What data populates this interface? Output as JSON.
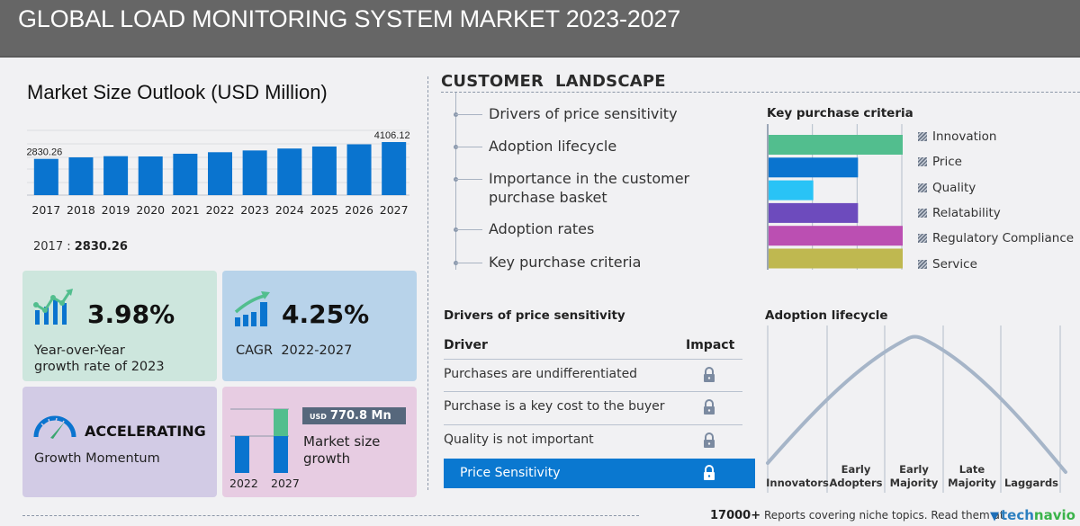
{
  "header": {
    "title": "GLOBAL LOAD MONITORING SYSTEM MARKET 2023-2027"
  },
  "market_size": {
    "title": "Market Size Outlook (USD Million)",
    "selected_year": "2017 :",
    "selected_value": "2830.26"
  },
  "chart_data": [
    {
      "type": "bar",
      "title": "Market Size Outlook (USD Million)",
      "categories": [
        "2017",
        "2018",
        "2019",
        "2020",
        "2021",
        "2022",
        "2023",
        "2024",
        "2025",
        "2026",
        "2027"
      ],
      "values": [
        2830.26,
        2945,
        3035,
        3015,
        3220,
        3335.3,
        3468.1,
        3615,
        3770,
        3935,
        4106.12
      ],
      "data_labels": {
        "2017": "2830.26",
        "2027": "4106.12"
      },
      "xlabel": "",
      "ylabel": "USD Million",
      "grid": true,
      "color": "#0a74cf"
    },
    {
      "type": "bar",
      "orientation": "horizontal",
      "title": "Key purchase criteria",
      "categories": [
        "Innovation",
        "Price",
        "Quality",
        "Relatability",
        "Regulatory Compliance",
        "Service"
      ],
      "values": [
        3,
        2,
        1,
        2,
        3,
        3
      ],
      "xlim": [
        0,
        3
      ],
      "colors": [
        "#52be8e",
        "#0a74cf",
        "#29c3f6",
        "#6d4bbd",
        "#bb4fb2",
        "#bfb850"
      ],
      "legend": "right"
    },
    {
      "type": "line",
      "title": "Adoption lifecycle",
      "categories": [
        "Innovators",
        "Early Adopters",
        "Early Majority",
        "Late Majority",
        "Laggards"
      ],
      "curve": "bell",
      "peak_stage": "Early Majority"
    }
  ],
  "cards": {
    "yoy": {
      "value": "3.98%",
      "label_line1": "Year-over-Year",
      "label_line2": "growth rate of 2023"
    },
    "cagr": {
      "value": "4.25%",
      "label": "CAGR  2022-2027"
    },
    "momentum": {
      "value": "ACCELERATING",
      "label": "Growth Momentum"
    },
    "growth": {
      "currency": "USD",
      "amount": "770.8 Mn",
      "label_line1": "Market size",
      "label_line2": "growth",
      "year_start": "2022",
      "year_end": "2027"
    }
  },
  "customer_landscape": {
    "title": "CUSTOMER  LANDSCAPE",
    "items": [
      {
        "line1": "Drivers of price sensitivity"
      },
      {
        "line1": "Adoption lifecycle"
      },
      {
        "line1": "Importance in the customer",
        "line2": "purchase basket"
      },
      {
        "line1": "Adoption rates"
      },
      {
        "line1": "Key purchase criteria"
      }
    ]
  },
  "key_purchase_criteria": {
    "title": "Key purchase criteria",
    "legend": [
      "Innovation",
      "Price",
      "Quality",
      "Relatability",
      "Regulatory Compliance",
      "Service"
    ]
  },
  "price_sensitivity": {
    "title": "Drivers of price sensitivity",
    "col_driver": "Driver",
    "col_impact": "Impact",
    "rows": [
      "Purchases are undifferentiated",
      "Purchase is a key cost to the buyer",
      "Quality is not important"
    ],
    "highlight": "Price Sensitivity",
    "impact_icon": "lock-icon"
  },
  "adoption_lifecycle": {
    "title": "Adoption lifecycle",
    "stages": [
      {
        "line1": "",
        "line2": "Innovators"
      },
      {
        "line1": "Early",
        "line2": "Adopters"
      },
      {
        "line1": "Early",
        "line2": "Majority"
      },
      {
        "line1": "Late",
        "line2": "Majority"
      },
      {
        "line1": "",
        "line2": "Laggards"
      }
    ]
  },
  "footer": {
    "count": "17000+",
    "text": "Reports covering niche topics. Read them at",
    "brand_a": "tech",
    "brand_b": "navio"
  },
  "colors": {
    "header_bg": "#666666",
    "primary_blue": "#0a74cf",
    "green": "#52be8e",
    "card_yoy": "#cde6dd",
    "card_cagr": "#b8d3ea",
    "card_momentum": "#d2cbe5",
    "card_growth": "#e7cce2"
  }
}
